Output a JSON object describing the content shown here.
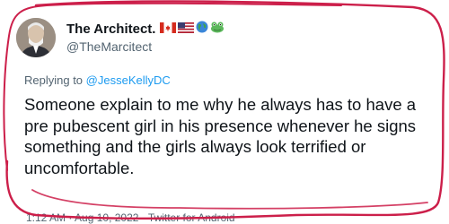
{
  "tweet": {
    "display_name": "The Architect.",
    "handle": "@TheMarcitect",
    "badges": [
      "canada-flag-icon",
      "usa-flag-icon",
      "globe-icon",
      "frog-icon"
    ],
    "reply_prefix": "Replying to",
    "reply_to": "@JesseKellyDC",
    "text": "Someone explain to me why he always has to have a pre pubescent girl in his presence whenever he signs something and the girls always look terrified or uncomfortable.",
    "timestamp": "1:12 AM · Aug 10, 2022 · Twitter for Android"
  },
  "colors": {
    "accent_link": "#1d9bf0",
    "secondary_text": "#536471",
    "annotation_scribble": "#cc1f4a"
  }
}
